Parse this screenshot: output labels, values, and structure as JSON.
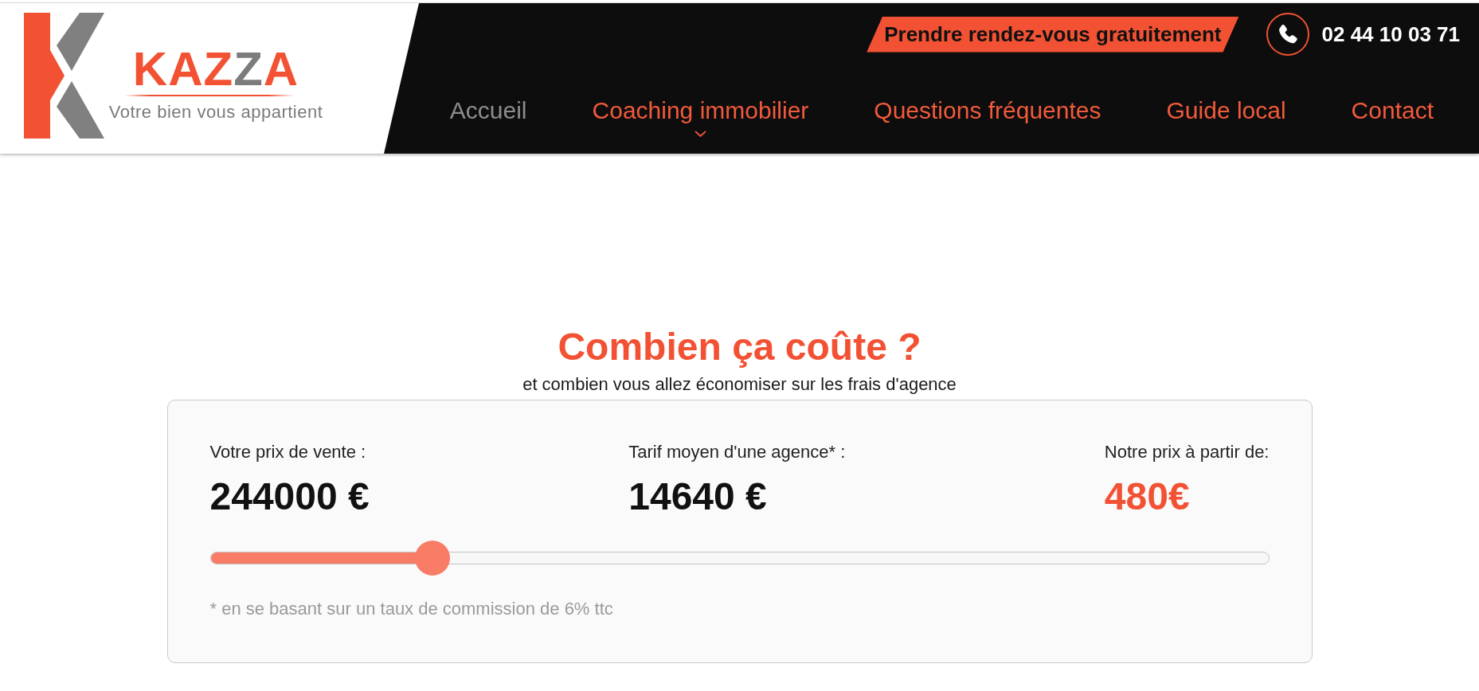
{
  "header": {
    "logo": {
      "wordmark": "KAZZA",
      "tagline": "Votre bien vous appartient"
    },
    "cta_button": "Prendre rendez-vous gratuitement",
    "phone": "02 44 10 03 71",
    "nav": [
      {
        "label": "Accueil",
        "selected": true,
        "has_submenu": false
      },
      {
        "label": "Coaching immobilier",
        "selected": false,
        "has_submenu": true
      },
      {
        "label": "Questions fréquentes",
        "selected": false,
        "has_submenu": false
      },
      {
        "label": "Guide local",
        "selected": false,
        "has_submenu": false
      },
      {
        "label": "Contact",
        "selected": false,
        "has_submenu": false
      }
    ]
  },
  "pricing": {
    "title": "Combien ça coûte ?",
    "subtitle": "et combien vous allez économiser sur les frais d'agence",
    "figures": [
      {
        "label": "Votre prix de vente :",
        "value": "244000 €",
        "highlighted": false
      },
      {
        "label": "Tarif moyen d'une agence* :",
        "value": "14640 €",
        "highlighted": false
      },
      {
        "label": "Notre prix à partir de:",
        "value": "480€",
        "highlighted": true
      }
    ],
    "slider": {
      "level": 0.21
    },
    "footnote": "* en se basant sur un taux de commission de 6% ttc"
  }
}
